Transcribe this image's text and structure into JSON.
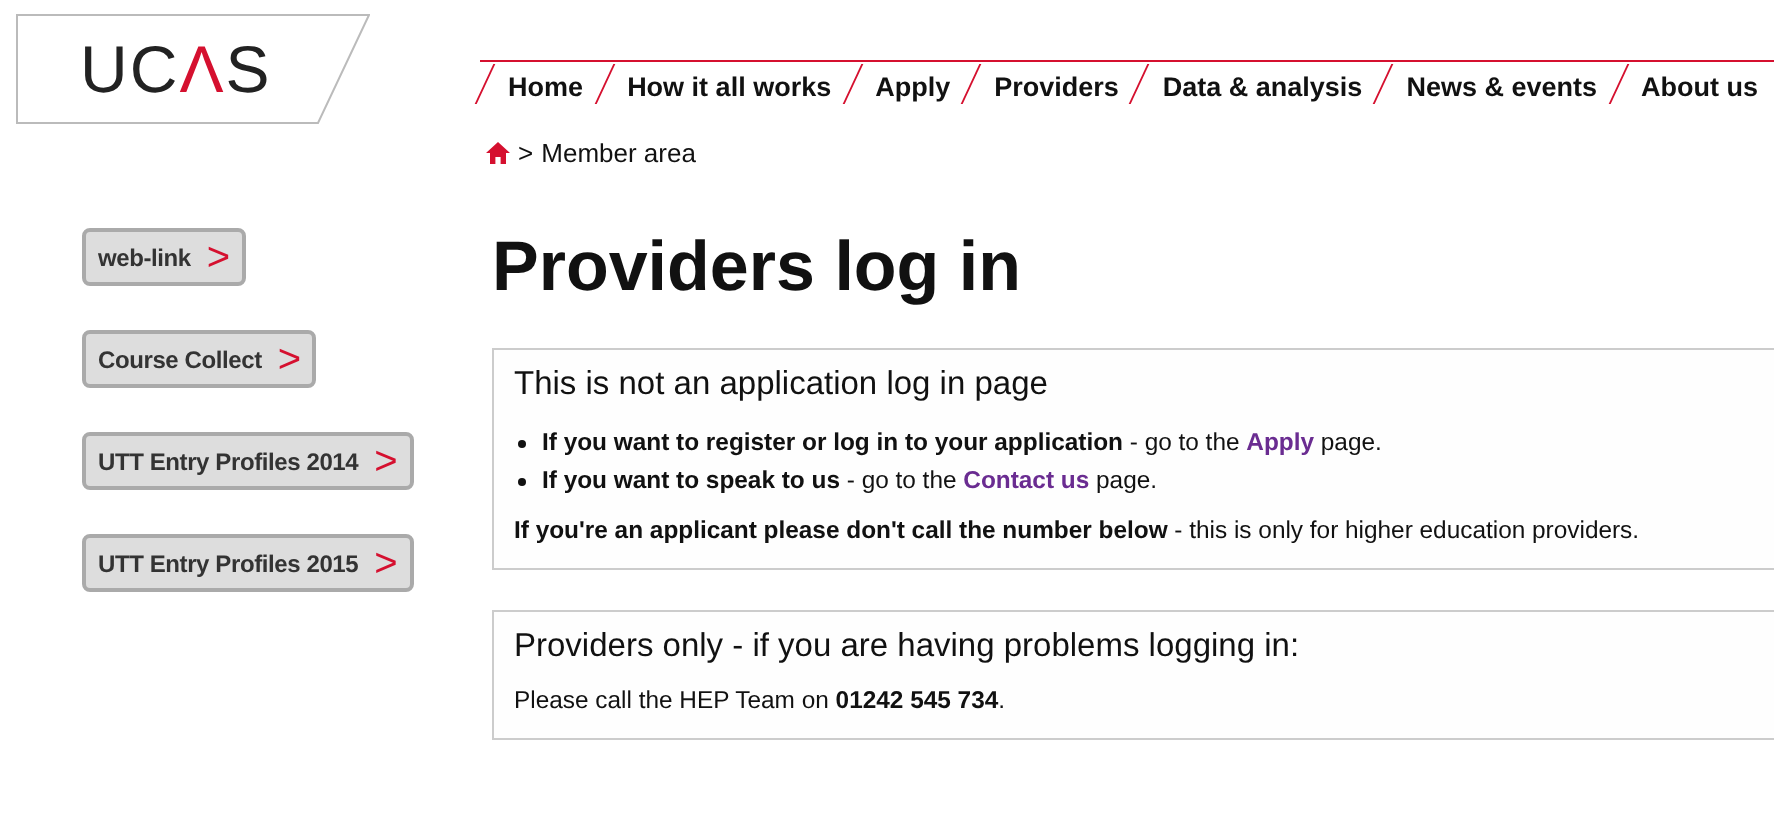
{
  "logo": {
    "letters": [
      {
        "char": "U",
        "accent": false
      },
      {
        "char": "C",
        "accent": false
      },
      {
        "char": "Λ",
        "accent": true
      },
      {
        "char": "S",
        "accent": false
      }
    ]
  },
  "nav": [
    {
      "label": "Home"
    },
    {
      "label": "How it all works"
    },
    {
      "label": "Apply"
    },
    {
      "label": "Providers"
    },
    {
      "label": "Data & analysis"
    },
    {
      "label": "News & events"
    },
    {
      "label": "About us"
    }
  ],
  "breadcrumb": {
    "separator": ">",
    "current": "Member area"
  },
  "sidebar": [
    {
      "label": "web-link",
      "arrow": ">"
    },
    {
      "label": "Course Collect",
      "arrow": ">"
    },
    {
      "label": "UTT Entry Profiles 2014",
      "arrow": ">"
    },
    {
      "label": "UTT Entry Profiles 2015",
      "arrow": ">"
    }
  ],
  "page_title": "Providers log in",
  "notice": {
    "title": "This is not an application log in page",
    "bullets": [
      {
        "lead": "**If you want to register or log in to your application** - go to the",
        "link": "Apply",
        "tail": "page."
      },
      {
        "lead": "**If you want to speak to us** - go to the",
        "link": "Contact us",
        "tail": "page."
      }
    ],
    "warning": "**If you're an applicant please don't call the number below** - this is only for higher education providers."
  },
  "help": {
    "title": "Providers only - if you are having problems logging in:",
    "text": "Please call the HEP Team on **01242 545 734**."
  }
}
